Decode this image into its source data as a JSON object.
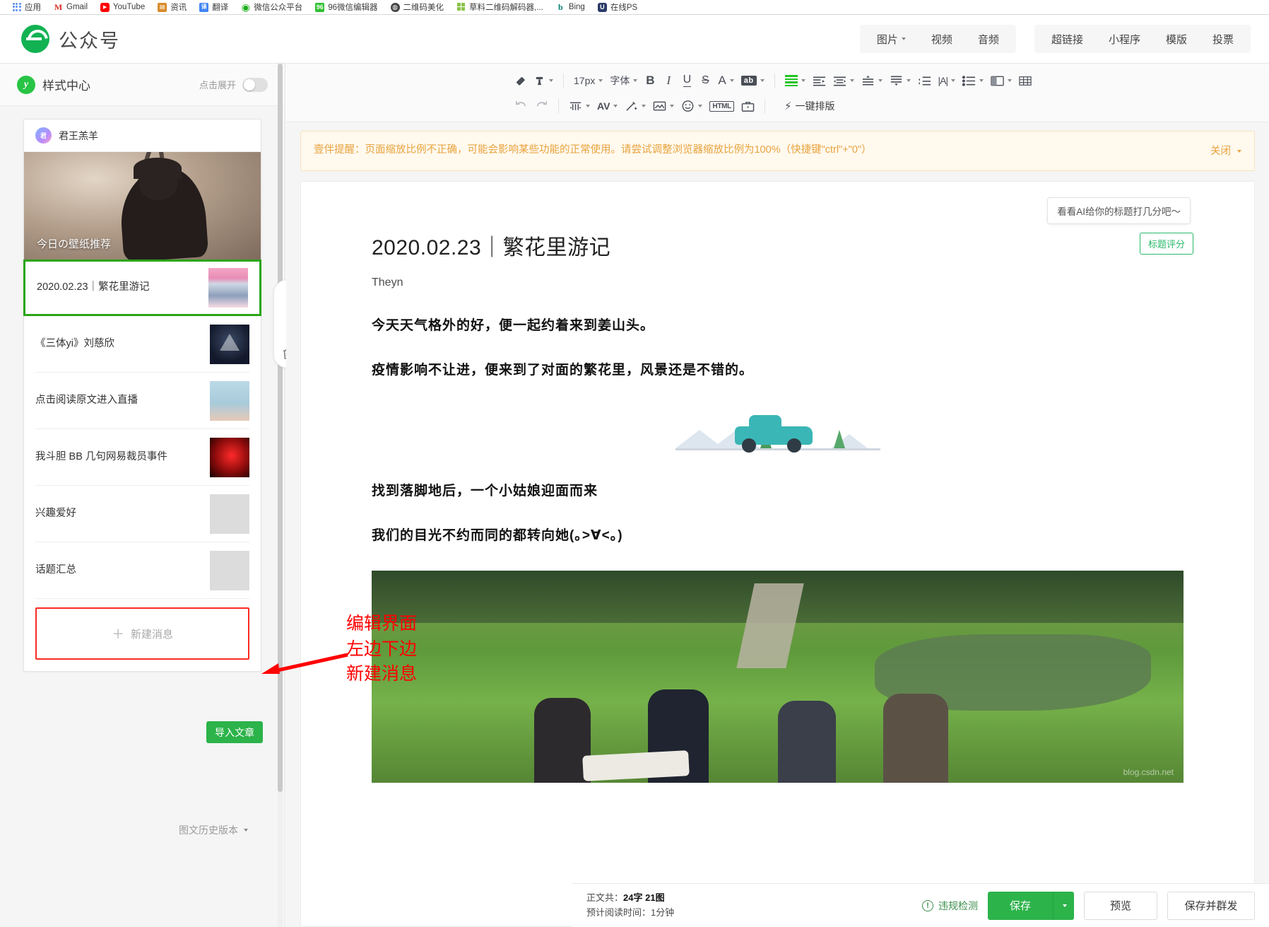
{
  "browser": {
    "bookmarks": [
      {
        "label": "应用",
        "icon": "apps-grid-icon"
      },
      {
        "label": "Gmail",
        "icon": "gmail-icon"
      },
      {
        "label": "YouTube",
        "icon": "youtube-icon"
      },
      {
        "label": "资讯",
        "icon": "news-icon"
      },
      {
        "label": "翻译",
        "icon": "translate-icon"
      },
      {
        "label": "微信公众平台",
        "icon": "wechat-icon"
      },
      {
        "label": "96微信编辑器",
        "icon": "editor96-icon"
      },
      {
        "label": "二维码美化",
        "icon": "qrcode-icon"
      },
      {
        "label": "草料二维码解码器,...",
        "icon": "caoliao-icon"
      },
      {
        "label": "Bing",
        "icon": "bing-icon"
      },
      {
        "label": "在线PS",
        "icon": "onlineps-icon"
      }
    ]
  },
  "header": {
    "brand": "公众号",
    "menu_groups": [
      {
        "items": [
          {
            "label": "图片",
            "has_caret": true
          },
          {
            "label": "视频",
            "has_caret": false
          },
          {
            "label": "音频",
            "has_caret": false
          }
        ]
      },
      {
        "items": [
          {
            "label": "超链接",
            "has_caret": false
          },
          {
            "label": "小程序",
            "has_caret": false
          },
          {
            "label": "模版",
            "has_caret": false
          },
          {
            "label": "投票",
            "has_caret": false
          }
        ]
      }
    ]
  },
  "left_panel": {
    "style_center": {
      "title": "样式中心",
      "hint": "点击展开",
      "toggle_on": false
    },
    "card": {
      "account_name": "君王羔羊",
      "cover_label": "今日の壁纸推荐",
      "articles": [
        {
          "title": "2020.02.23｜繁花里游记",
          "selected": true,
          "thumb": "flower"
        },
        {
          "title": "《三体yi》刘慈欣",
          "selected": false,
          "thumb": "santi"
        },
        {
          "title": "点击阅读原文进入直播",
          "selected": false,
          "thumb": "hands"
        },
        {
          "title": "我斗胆 BB 几句网易裁员事件",
          "selected": false,
          "thumb": "red"
        },
        {
          "title": "兴趣爱好",
          "selected": false,
          "thumb": "gray"
        },
        {
          "title": "话题汇总",
          "selected": false,
          "thumb": "gray"
        }
      ],
      "new_message_label": "新建消息",
      "new_message_plus": "＋"
    },
    "import_label": "导入文章",
    "history_label": "图文历史版本",
    "rail": [
      {
        "name": "move-up",
        "glyph": "↑"
      },
      {
        "name": "move-down",
        "glyph": "↓"
      },
      {
        "name": "delete",
        "glyph": "🗑"
      }
    ]
  },
  "toolbar": {
    "row1": [
      {
        "name": "clear-format-icon",
        "glyph": "◆",
        "caret": false
      },
      {
        "name": "format-brush-icon",
        "glyph": "brush",
        "caret": true
      },
      {
        "name": "font-size-select",
        "glyph": "17px",
        "caret": true,
        "type": "text"
      },
      {
        "name": "font-family-select",
        "glyph": "字体",
        "caret": true,
        "type": "text"
      },
      {
        "name": "bold-icon",
        "glyph": "B",
        "caret": false
      },
      {
        "name": "italic-icon",
        "glyph": "I",
        "caret": false
      },
      {
        "name": "underline-icon",
        "glyph": "U",
        "caret": false
      },
      {
        "name": "strikethrough-icon",
        "glyph": "S",
        "caret": false
      },
      {
        "name": "text-color-icon",
        "glyph": "A",
        "caret": true
      },
      {
        "name": "highlight-color-icon",
        "glyph": "ab",
        "caret": true
      },
      {
        "name": "align-icon",
        "glyph": "align",
        "caret": true
      },
      {
        "name": "indent-increase-icon",
        "glyph": "indent",
        "caret": false
      },
      {
        "name": "indent-decrease-icon",
        "glyph": "outdent",
        "caret": true
      },
      {
        "name": "paragraph-spacing-icon",
        "glyph": "spacing",
        "caret": true
      },
      {
        "name": "line-height-icon",
        "glyph": "lineheight",
        "caret": true
      },
      {
        "name": "letter-spacing-icon",
        "glyph": "letterspacing",
        "caret": true
      },
      {
        "name": "text-direction-icon",
        "glyph": "|A|",
        "caret": true
      },
      {
        "name": "list-icon",
        "glyph": "list",
        "caret": true
      },
      {
        "name": "layout-icon",
        "glyph": "layout",
        "caret": true
      },
      {
        "name": "table-icon",
        "glyph": "table",
        "caret": false
      }
    ],
    "row2": [
      {
        "name": "undo-icon",
        "glyph": "↶",
        "caret": false
      },
      {
        "name": "redo-icon",
        "glyph": "↷",
        "caret": false
      },
      {
        "name": "column-icon",
        "glyph": "columns",
        "caret": true
      },
      {
        "name": "kerning-icon",
        "glyph": "AV",
        "caret": true
      },
      {
        "name": "magic-wand-icon",
        "glyph": "wand",
        "caret": true
      },
      {
        "name": "insert-image-icon",
        "glyph": "image",
        "caret": true
      },
      {
        "name": "emoji-icon",
        "glyph": "☺",
        "caret": true
      },
      {
        "name": "html-icon",
        "glyph": "HTML",
        "caret": false
      },
      {
        "name": "toolbox-icon",
        "glyph": "toolbox",
        "caret": false
      }
    ],
    "onekey_label": "一键排版"
  },
  "warning": {
    "text": "壹伴提醒：页面缩放比例不正确，可能会影响某些功能的正常使用。请尝试调整浏览器缩放比例为100%（快捷键\"ctrl\"+\"0\"）",
    "close_label": "关闭"
  },
  "document": {
    "ai_tip": "看看AI给你的标题打几分吧～",
    "score_badge": "标题评分",
    "title": "2020.02.23｜繁花里游记",
    "author": "Theyn",
    "paragraphs": [
      "今天天气格外的好，便一起约着来到姜山头。",
      "疫情影响不让进，便来到了对面的繁花里，风景还是不错的。"
    ],
    "paragraphs2": [
      "找到落脚地后，一个小姑娘迎面而来",
      "我们的目光不约而同的都转向她(｡>∀<｡)"
    ],
    "photo_watermark": "blog.csdn.net"
  },
  "bottom_bar": {
    "count_line1_prefix": "正文共：",
    "count_chars": "24字",
    "count_images": "21图",
    "count_line2_prefix": "预计阅读时间：",
    "read_time": "1分钟",
    "check_label": "违规检测",
    "save_label": "保存",
    "preview_label": "预览",
    "mass_send_label": "保存并群发"
  },
  "annotation": {
    "lines": [
      "编辑界面",
      "左边下边",
      "新建消息"
    ],
    "color": "#ff0000"
  },
  "colors": {
    "brand_green": "#12b252",
    "accent_green": "#2cb34a",
    "selected_border": "#2aa515",
    "warning": "#e8a33d",
    "annotation_red": "#ff0000"
  }
}
